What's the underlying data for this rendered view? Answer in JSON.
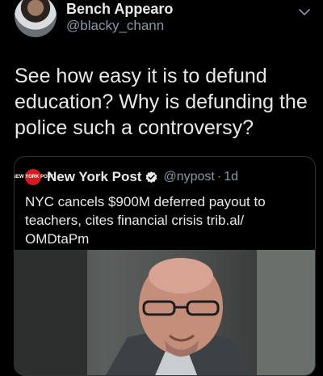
{
  "author": {
    "display_name": "Bench Appearo",
    "handle": "@blacky_chann"
  },
  "tweet": {
    "text": "See how easy it is to defund\neducation? Why is defunding the\npolice such a controversy?"
  },
  "quoted": {
    "logo_text": "NEW YORK POST",
    "name": "New York Post",
    "handle": "@nypost",
    "separator": "·",
    "time": "1d",
    "text": "NYC cancels $900M deferred payout to\nteachers, cites financial crisis trib.al/\nOMDtaPm"
  },
  "colors": {
    "background": "#000000",
    "text": "#e7e9ea",
    "secondary": "#8b98a5",
    "border": "#2f3336",
    "nypost_red": "#d71a20"
  },
  "icons": [
    "avatar",
    "chevron-down-icon",
    "nypost-logo",
    "verified-badge-icon"
  ]
}
